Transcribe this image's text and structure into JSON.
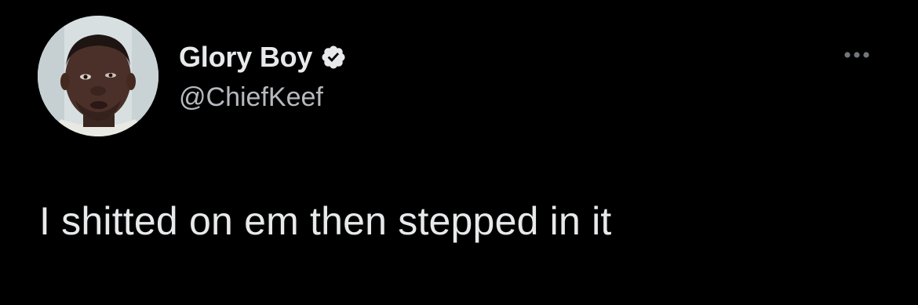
{
  "tweet": {
    "author": {
      "display_name": "Glory Boy",
      "handle": "@ChiefKeef",
      "verified": true,
      "avatar_icon": "avatar-photo"
    },
    "text": "I shitted on em then stepped in it",
    "more_icon": "more-horizontal-icon"
  },
  "colors": {
    "background": "#000000",
    "primary_text": "#e7e9ea",
    "secondary_text": "#b6babe"
  }
}
